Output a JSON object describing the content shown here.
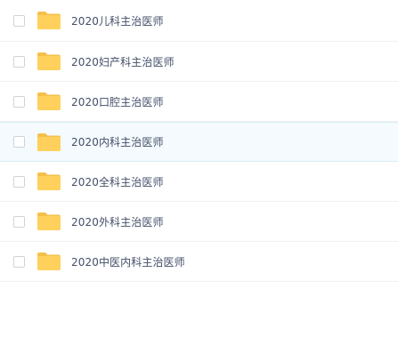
{
  "files": [
    {
      "name": "2020儿科主治医师",
      "icon": "folder-icon",
      "highlighted": false
    },
    {
      "name": "2020妇产科主治医师",
      "icon": "folder-icon",
      "highlighted": false
    },
    {
      "name": "2020口腔主治医师",
      "icon": "folder-icon",
      "highlighted": false
    },
    {
      "name": "2020内科主治医师",
      "icon": "folder-icon",
      "highlighted": true
    },
    {
      "name": "2020全科主治医师",
      "icon": "folder-icon",
      "highlighted": false
    },
    {
      "name": "2020外科主治医师",
      "icon": "folder-icon",
      "highlighted": false
    },
    {
      "name": "2020中医内科主治医师",
      "icon": "folder-icon",
      "highlighted": false
    }
  ],
  "colors": {
    "folder": "#ffd15c",
    "folder_tab": "#f5c04a",
    "row_highlight": "#f4fafd",
    "text": "#424e67"
  }
}
